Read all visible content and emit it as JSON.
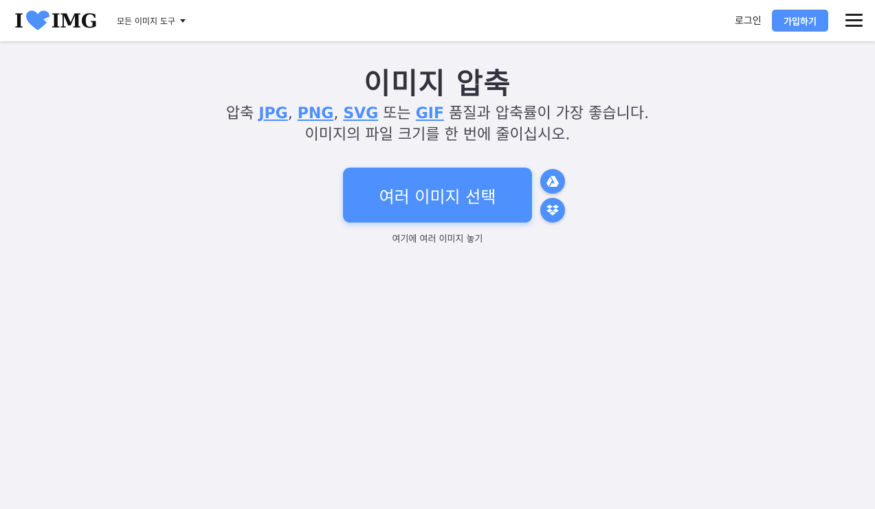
{
  "header": {
    "logo": {
      "prefix": "I",
      "suffix": "IMG"
    },
    "tools_menu_label": "모든 이미지 도구",
    "login_label": "로그인",
    "signup_label": "가입하기"
  },
  "main": {
    "title": "이미지 압축",
    "subtitle": {
      "lead": "압축 ",
      "formats": [
        "JPG",
        "PNG",
        "SVG",
        "GIF"
      ],
      "sep1": ", ",
      "sep2": ", ",
      "connector": " 또는 ",
      "tail": " 품질과 압축률이 가장 좋습니다.",
      "line2": "이미지의 파일 크기를 한 번에 줄이십시오."
    },
    "select_button_label": "여러 이미지 선택",
    "drop_hint": "여기에 여러 이미지 놓기",
    "cloud_sources": [
      "google-drive-icon",
      "dropbox-icon"
    ]
  },
  "colors": {
    "accent": "#4d90fe",
    "background": "#f3f2f7",
    "header_bg": "#ffffff",
    "title_text": "#33333b"
  }
}
